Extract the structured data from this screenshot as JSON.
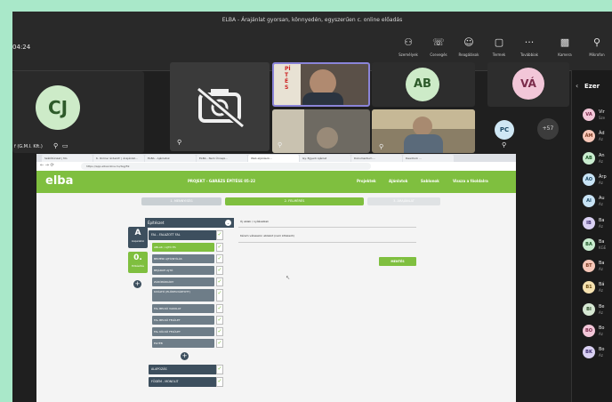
{
  "window": {
    "title": "ELBA - Árajánlat gyorsan, könnyedén, egyszerűen c. online előadás"
  },
  "meeting": {
    "timer": "04:24",
    "toolbar": [
      {
        "label": "Személyek",
        "icon": "people-icon",
        "glyph": "⚇"
      },
      {
        "label": "Csevegés",
        "icon": "chat-icon",
        "glyph": "☏"
      },
      {
        "label": "Reagálások",
        "icon": "reactions-icon",
        "glyph": "☺"
      },
      {
        "label": "Termek",
        "icon": "rooms-icon",
        "glyph": "▢"
      },
      {
        "label": "Továbbiak",
        "icon": "more-icon",
        "glyph": "···"
      },
      {
        "label": "Kamera",
        "icon": "camera-off-icon",
        "glyph": "▩"
      },
      {
        "label": "Mikrofon",
        "icon": "mic-off-icon",
        "glyph": "⚲"
      }
    ]
  },
  "participants": {
    "presenter_label": "f (G.M.I. Kft.)",
    "cj_initials": "CJ",
    "ab_initials": "AB",
    "va_initials": "VÁ",
    "pc_initials": "PC",
    "more_count": "+57",
    "camera_off_icon": "camera-off-icon",
    "video_banner_text": "PÍTÉS"
  },
  "panel": {
    "title": "Ezer",
    "people": [
      {
        "initials": "VA",
        "name": "Vir",
        "sub": "Sze",
        "color": "#f2c6d8",
        "text": "#7a2a4a"
      },
      {
        "initials": "ÁM",
        "name": "Ád",
        "sub": "Az",
        "color": "#f7c7b8",
        "text": "#7a3a22"
      },
      {
        "initials": "AB",
        "name": "An",
        "sub": "Az",
        "color": "#c9eccf",
        "text": "#205a2a"
      },
      {
        "initials": "ÁO",
        "name": "Árp",
        "sub": "Az",
        "color": "#c8e3f5",
        "text": "#1e4a66"
      },
      {
        "initials": "AI",
        "name": "Au",
        "sub": "Az",
        "color": "#c8e3f5",
        "text": "#1e4a66"
      },
      {
        "initials": "IB",
        "name": "Ba",
        "sub": "Az",
        "color": "#d9d0f2",
        "text": "#3b2a6e"
      },
      {
        "initials": "BA",
        "name": "Ba",
        "sub": "KGE",
        "color": "#c9eccf",
        "text": "#205a2a"
      },
      {
        "initials": "BT",
        "name": "Ba",
        "sub": "Az",
        "color": "#f7c7b8",
        "text": "#7a3a22"
      },
      {
        "initials": "B1",
        "name": "Bá",
        "sub": "Az",
        "color": "#f6e2b0",
        "text": "#6a4c12"
      },
      {
        "initials": "BI",
        "name": "Be",
        "sub": "Az",
        "color": "#d6e8d3",
        "text": "#2e4f2a"
      },
      {
        "initials": "BO",
        "name": "Bo",
        "sub": "Az",
        "color": "#f2c6d8",
        "text": "#7a2a4a"
      },
      {
        "initials": "BK",
        "name": "Bo",
        "sub": "Az",
        "color": "#d9d0f2",
        "text": "#3b2a6e"
      }
    ]
  },
  "share": {
    "browser_tabs": [
      "Szállítóinkat | Mo",
      "K. Online 'érdeklő' | Árajánlat...",
      "ELBA - Ajánlatok",
      "ELBA - Nem Ünnepi...",
      "Web eljárások...",
      "Gy. Egyedi Ajánlat",
      "Dokumentum ...",
      "Deadlock ..."
    ],
    "url": "https://app.elbaonline.hu/tag/59",
    "logo": "elba",
    "project_title": "PROJEKT - GARÁZS ÉPÍTÉSE 05-22",
    "nav": [
      "Projektek",
      "Ajánlatok",
      "Sablonok",
      "Vissza a főoldalra"
    ],
    "steps": [
      "1. MENNYISÉG",
      "2. FELMÉRÉS",
      "3. ÁRAJÁNLAT"
    ],
    "left_tools": [
      {
        "big": "A",
        "small": "Alapadatok"
      },
      {
        "big": "0.",
        "small": "Előkészítés"
      }
    ],
    "tree_title": "Építészet",
    "sections": [
      {
        "label": "FAL - FALAZOTT FAL",
        "items": [
          {
            "label": "ABLAK / AJTÓ ÉS",
            "active": true
          },
          {
            "label": "BELTÉRI AJTÓ/NYÍLÁS",
            "active": false
          },
          {
            "label": "BEJÁRATI AJTÓ",
            "active": false
          },
          {
            "label": "ZÁRÓPÁRKÁNY",
            "active": false
          },
          {
            "label": "KIVÁLTÓ (ELŐREGYÁRTOTT)",
            "active": false
          },
          {
            "label": "FAL BELSŐ VAKOLAT",
            "active": false
          },
          {
            "label": "FAL BELSŐ FELÜLET",
            "active": false
          },
          {
            "label": "FAL KÜLSŐ FELÜLET",
            "active": false
          },
          {
            "label": "EGYÉB",
            "active": false
          }
        ]
      },
      {
        "label": "ALAPOZÁS",
        "items": []
      },
      {
        "label": "FÖDÉM - MONOLIT",
        "items": []
      }
    ],
    "form": {
      "label1": "Új ablak / nyílásablak",
      "label2": "Kérem válasszon ablakot (nem kötelező)",
      "save": "MENTÉS"
    }
  }
}
